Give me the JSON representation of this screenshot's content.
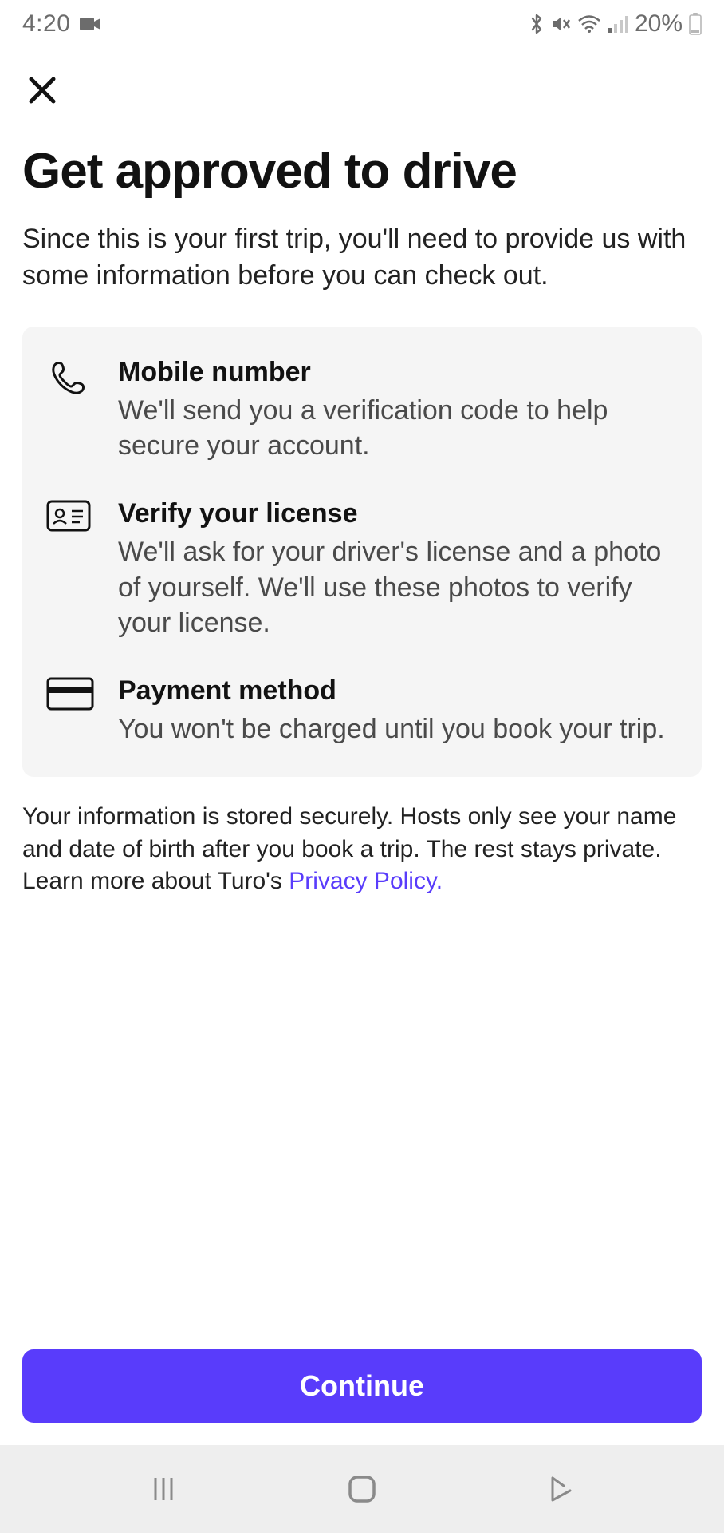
{
  "status": {
    "time": "4:20",
    "battery_percent": "20%"
  },
  "page": {
    "title": "Get approved to drive",
    "subtitle": "Since this is your first trip, you'll need to provide us with some information before you can check out."
  },
  "steps": [
    {
      "icon": "phone-icon",
      "title": "Mobile number",
      "desc": "We'll send you a verification code to help secure your account."
    },
    {
      "icon": "license-icon",
      "title": "Verify your license",
      "desc": "We'll ask for your driver's license and a photo of yourself. We'll use these photos to verify your license."
    },
    {
      "icon": "card-icon",
      "title": "Payment method",
      "desc": "You won't be charged until you book your trip."
    }
  ],
  "privacy": {
    "text_before": "Your information is stored securely. Hosts only see your name and date of birth after you book a trip. The rest stays private. Learn more about Turo's ",
    "link_text": "Privacy Policy.",
    "text_after": ""
  },
  "actions": {
    "continue_label": "Continue"
  }
}
